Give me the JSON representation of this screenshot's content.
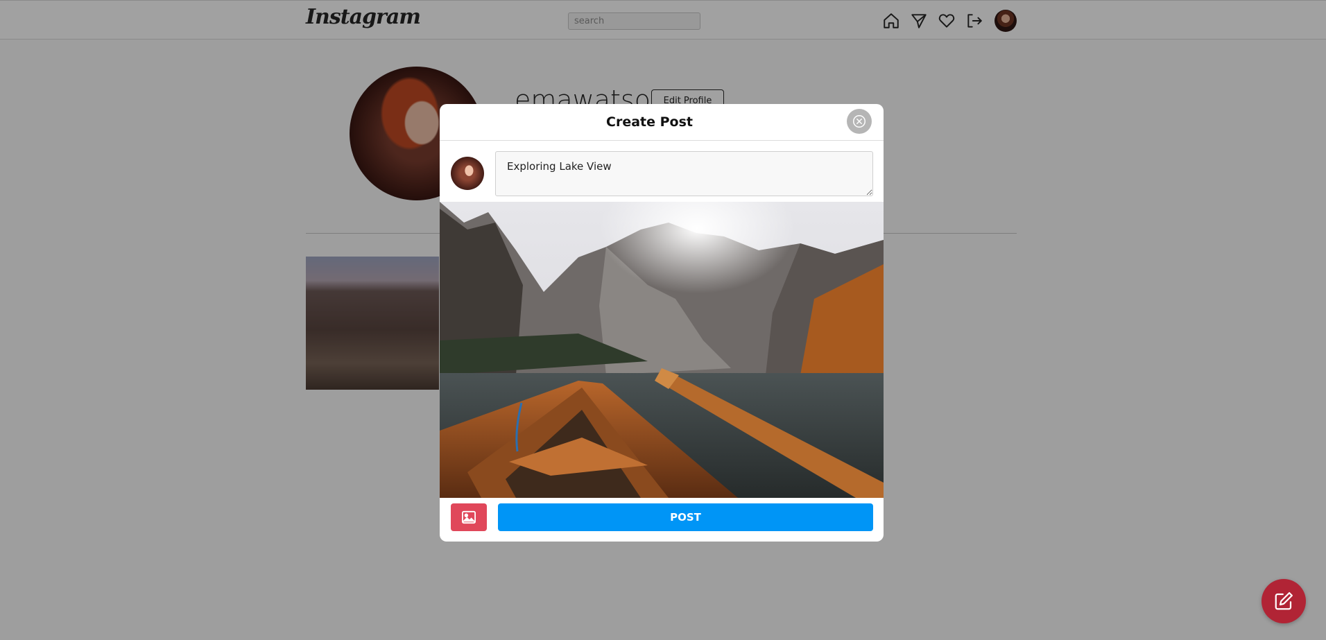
{
  "header": {
    "logo_text": "Instagram",
    "search_placeholder": "search",
    "icons": [
      "home-icon",
      "send-icon",
      "heart-icon",
      "logout-icon"
    ]
  },
  "profile": {
    "username": "emawatson",
    "edit_profile_label": "Edit Profile"
  },
  "modal": {
    "title": "Create Post",
    "caption_value": "Exploring Lake View",
    "post_button_label": "POST",
    "colors": {
      "image_button": "#e0475a",
      "post_button": "#0095f6",
      "close_button": "#b5b5b5"
    }
  },
  "fab": {
    "icon": "edit-icon",
    "color": "#b12435"
  }
}
